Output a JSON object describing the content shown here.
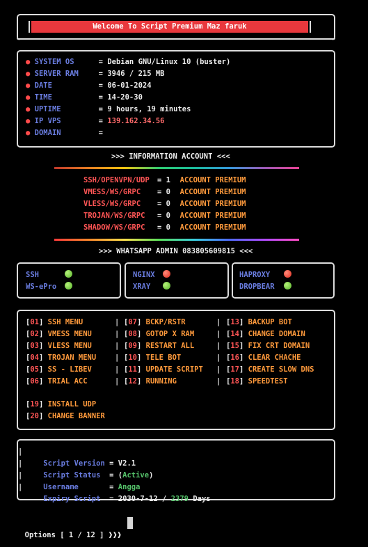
{
  "banner": {
    "title": "Welcome To Script Premium Maz faruk"
  },
  "system": [
    {
      "key": "SYSTEM OS",
      "eq": "=",
      "val": "Debian GNU/Linux 10 (buster)",
      "style": "white"
    },
    {
      "key": "SERVER RAM",
      "eq": "=",
      "val": "3946 / 215 MB",
      "style": "white"
    },
    {
      "key": "DATE",
      "eq": "=",
      "val": "06-01-2024",
      "style": "white"
    },
    {
      "key": "TIME",
      "eq": "=",
      "val": "14-20-30",
      "style": "white"
    },
    {
      "key": "UPTIME",
      "eq": "=",
      "val": "9 hours, 19 minutes",
      "style": "white"
    },
    {
      "key": "IP VPS",
      "eq": "=",
      "val": "139.162.34.56",
      "style": "lightred"
    },
    {
      "key": "DOMAIN",
      "eq": "=",
      "val": "",
      "style": "white"
    }
  ],
  "info_header": ">>> INFORMATION ACCOUNT <<<",
  "accounts": [
    {
      "proto": "SSH/OPENVPN/UDP",
      "eq": "=",
      "count": "1",
      "label": "ACCOUNT PREMIUM"
    },
    {
      "proto": "VMESS/WS/GRPC",
      "eq": "=",
      "count": "0",
      "label": "ACCOUNT PREMIUM"
    },
    {
      "proto": "VLESS/WS/GRPC",
      "eq": "=",
      "count": "0",
      "label": "ACCOUNT PREMIUM"
    },
    {
      "proto": "TROJAN/WS/GRPC",
      "eq": "=",
      "count": "0",
      "label": "ACCOUNT PREMIUM"
    },
    {
      "proto": "SHADOW/WS/GRPC",
      "eq": "=",
      "count": "0",
      "label": "ACCOUNT PREMIUM"
    }
  ],
  "whatsapp_header": ">>> WHATSAPP ADMIN 083805609815 <<<",
  "services": [
    {
      "name": "SSH",
      "status": "green"
    },
    {
      "name": "WS-ePro",
      "status": "green"
    },
    {
      "name": "NGINX",
      "status": "red"
    },
    {
      "name": "XRAY",
      "status": "green"
    },
    {
      "name": "HAPROXY",
      "status": "red"
    },
    {
      "name": "DROPBEAR",
      "status": "green"
    }
  ],
  "menu": {
    "col1": [
      {
        "num": "01",
        "label": "SSH MENU"
      },
      {
        "num": "02",
        "label": "VMESS MENU"
      },
      {
        "num": "03",
        "label": "VLESS MENU"
      },
      {
        "num": "04",
        "label": "TROJAN MENU"
      },
      {
        "num": "05",
        "label": "SS - LIBEV"
      },
      {
        "num": "06",
        "label": "TRIAL ACC"
      }
    ],
    "col2": [
      {
        "num": "07",
        "label": "BCKP/RSTR"
      },
      {
        "num": "08",
        "label": "GOTOP X RAM"
      },
      {
        "num": "09",
        "label": "RESTART ALL"
      },
      {
        "num": "10",
        "label": "TELE BOT"
      },
      {
        "num": "11",
        "label": "UPDATE SCRIPT"
      },
      {
        "num": "12",
        "label": "RUNNING"
      }
    ],
    "col3": [
      {
        "num": "13",
        "label": "BACKUP BOT"
      },
      {
        "num": "14",
        "label": "CHANGE DOMAIN"
      },
      {
        "num": "15",
        "label": "FIX CRT DOMAIN"
      },
      {
        "num": "16",
        "label": "CLEAR CHACHE"
      },
      {
        "num": "17",
        "label": "CREATE SLOW DNS"
      },
      {
        "num": "18",
        "label": "SPEEDTEST"
      }
    ],
    "extra": [
      {
        "num": "19",
        "label": "INSTALL UDP"
      },
      {
        "num": "20",
        "label": "CHANGE BANNER"
      }
    ]
  },
  "script_info": {
    "version_key": "Script Version",
    "version_val": "V2.1",
    "status_key": "Script Status",
    "status_open": "(",
    "status_val": "Active",
    "status_close": ")",
    "user_key": "Username",
    "user_val": "Angga",
    "expiry_key": "Expiry Script",
    "expiry_date": "2030-7-12",
    "expiry_sep": "/",
    "expiry_days": "2379",
    "expiry_unit": "Days",
    "eq": "="
  },
  "prompt": {
    "text": "Options [ 1 / 12 ]",
    "arrow": "❱❱❱"
  },
  "colors": {
    "banner_bg": "#e8383d",
    "key_blue": "#6a7de0",
    "menu_orange": "#ff9a3c",
    "account_red": "#ff5555",
    "active_green": "#55c26a"
  }
}
